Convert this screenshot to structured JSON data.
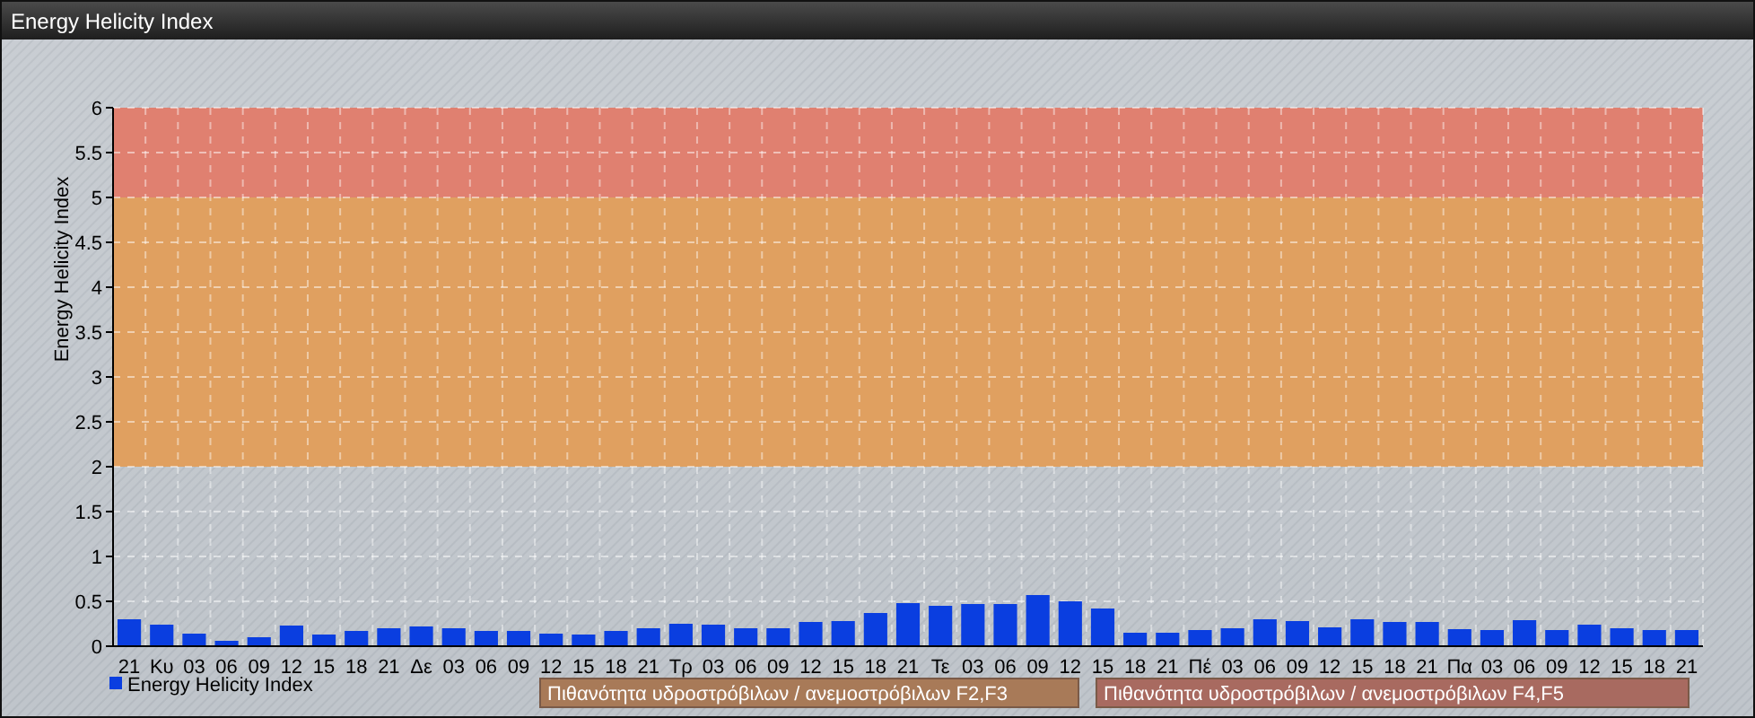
{
  "window": {
    "title": "Energy Helicity Index"
  },
  "chart": {
    "chart_data": {
      "type": "bar",
      "ylabel": "Energy Helicity Index",
      "categories": [
        "21",
        "Κυ",
        "03",
        "06",
        "09",
        "12",
        "15",
        "18",
        "21",
        "Δε",
        "03",
        "06",
        "09",
        "12",
        "15",
        "18",
        "21",
        "Τρ",
        "03",
        "06",
        "09",
        "12",
        "15",
        "18",
        "21",
        "Τε",
        "03",
        "06",
        "09",
        "12",
        "15",
        "18",
        "21",
        "Πέ",
        "03",
        "06",
        "09",
        "12",
        "15",
        "18",
        "21",
        "Πα",
        "03",
        "06",
        "09",
        "12",
        "15",
        "18",
        "21"
      ],
      "series": [
        {
          "name": "Energy Helicity Index",
          "color": "#0a3ee0",
          "values": [
            0.3,
            0.24,
            0.14,
            0.06,
            0.1,
            0.23,
            0.13,
            0.17,
            0.2,
            0.22,
            0.2,
            0.17,
            0.17,
            0.14,
            0.13,
            0.17,
            0.2,
            0.25,
            0.24,
            0.2,
            0.2,
            0.27,
            0.28,
            0.37,
            0.48,
            0.45,
            0.47,
            0.47,
            0.57,
            0.5,
            0.42,
            0.15,
            0.15,
            0.18,
            0.2,
            0.3,
            0.28,
            0.21,
            0.3,
            0.27,
            0.27,
            0.19,
            0.18,
            0.29,
            0.18,
            0.24,
            0.2,
            0.18,
            0.18
          ]
        }
      ],
      "ylim": [
        0,
        6
      ],
      "yticks": [
        0,
        0.5,
        1,
        1.5,
        2,
        2.5,
        3,
        3.5,
        4,
        4.5,
        5,
        5.5,
        6
      ],
      "grid": true,
      "bands": [
        {
          "axis": "y",
          "from": 2,
          "to": 5,
          "color": "#e0a060"
        },
        {
          "axis": "y",
          "from": 5,
          "to": 6,
          "color": "#e08070"
        }
      ]
    },
    "risk_legend": [
      {
        "label": "Πιθανότητα υδροστρόβιλων / ανεμοστρόβιλων F2,F3",
        "color": "#a87a58"
      },
      {
        "label": "Πιθανότητα υδροστρόβιλων / ανεμοστρόβιλων F4,F5",
        "color": "#a86a60"
      }
    ]
  }
}
